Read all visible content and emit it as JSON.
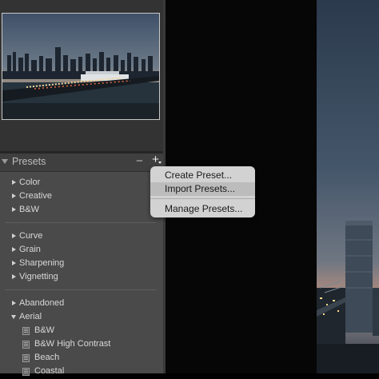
{
  "presets_panel": {
    "title": "Presets",
    "remove_label": "−",
    "add_label": "+",
    "groups": [
      {
        "label": "Color"
      },
      {
        "label": "Creative"
      },
      {
        "label": "B&W"
      },
      {
        "label": "Curve"
      },
      {
        "label": "Grain"
      },
      {
        "label": "Sharpening"
      },
      {
        "label": "Vignetting"
      },
      {
        "label": "Abandoned"
      },
      {
        "label": "Aerial"
      }
    ],
    "aerial_children": [
      {
        "label": "B&W"
      },
      {
        "label": "B&W High Contrast"
      },
      {
        "label": "Beach"
      },
      {
        "label": "Coastal"
      }
    ]
  },
  "menu": {
    "items": [
      {
        "label": "Create Preset..."
      },
      {
        "label": "Import Presets..."
      },
      {
        "label": "Manage Presets..."
      }
    ]
  },
  "colors": {
    "panel_bg": "#4a4a4a",
    "header_bg": "#3f3f3f",
    "menu_bg": "#d2d2d2",
    "menu_highlight": "#bcbcbc"
  }
}
